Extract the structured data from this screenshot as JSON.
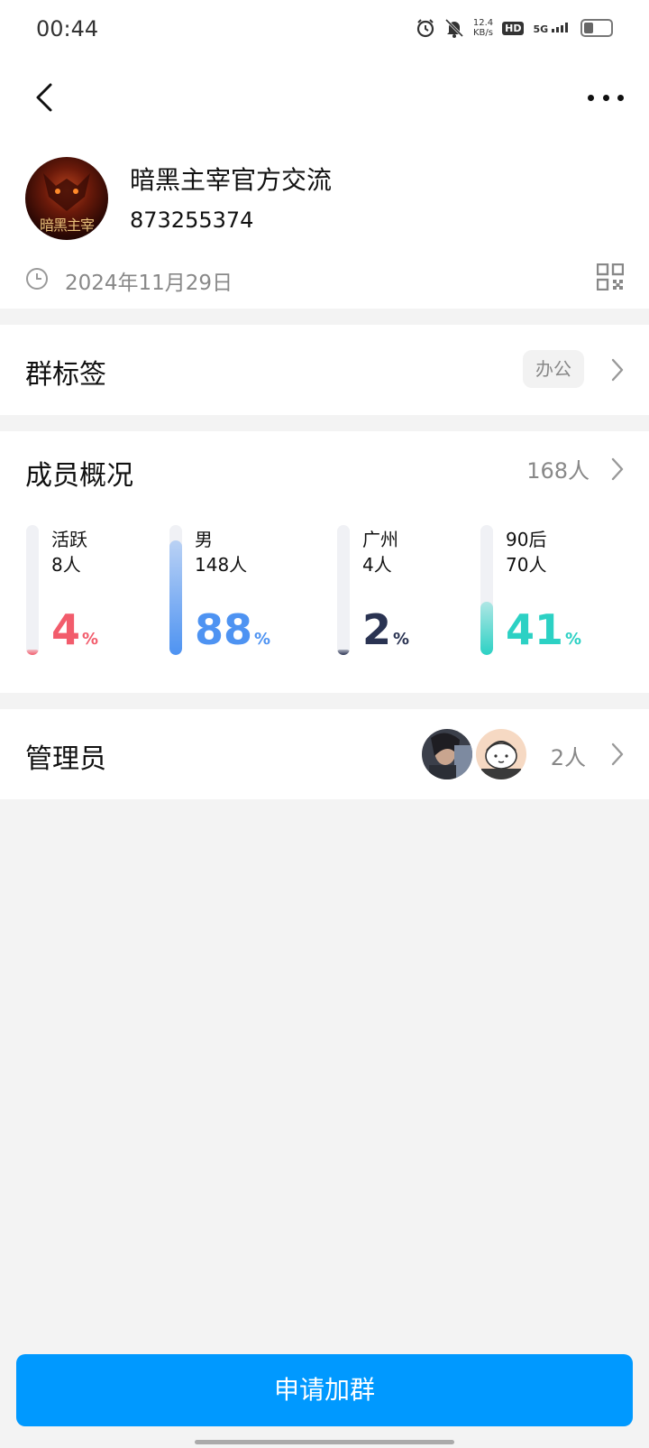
{
  "status_bar": {
    "time": "00:44",
    "net_speed_value": "12.4",
    "net_speed_unit": "KB/s",
    "hd": "HD",
    "signal": "5G",
    "icons": [
      "alarm-icon",
      "bell-muted-icon",
      "hd-icon",
      "signal-icon",
      "battery-icon"
    ]
  },
  "header": {
    "back_icon": "chevron-left-icon",
    "more_icon": "more-dots-icon"
  },
  "group": {
    "name": "暗黑主宰官方交流",
    "id": "873255374",
    "avatar_text": "暗黑主宰",
    "date": "2024年11月29日"
  },
  "tags": {
    "title": "群标签",
    "tag": "办公"
  },
  "members": {
    "title": "成员概况",
    "total": "168人",
    "stats": [
      {
        "label": "活跃",
        "count": "8人",
        "percent_value": "4",
        "percent_sign": "%",
        "fraction": 0.04,
        "color": "#f25c6c"
      },
      {
        "label": "男",
        "count": "148人",
        "percent_value": "88",
        "percent_sign": "%",
        "fraction": 0.88,
        "color": "#4e93f2"
      },
      {
        "label": "广州",
        "count": "4人",
        "percent_value": "2",
        "percent_sign": "%",
        "fraction": 0.02,
        "color": "#2a3352"
      },
      {
        "label": "90后",
        "count": "70人",
        "percent_value": "41",
        "percent_sign": "%",
        "fraction": 0.41,
        "color": "#2cd1c4"
      }
    ]
  },
  "admins": {
    "title": "管理员",
    "count": "2人"
  },
  "actions": {
    "join_label": "申请加群"
  },
  "colors": {
    "accent": "#0099ff",
    "muted_text": "#888888",
    "background": "#f3f3f3"
  }
}
